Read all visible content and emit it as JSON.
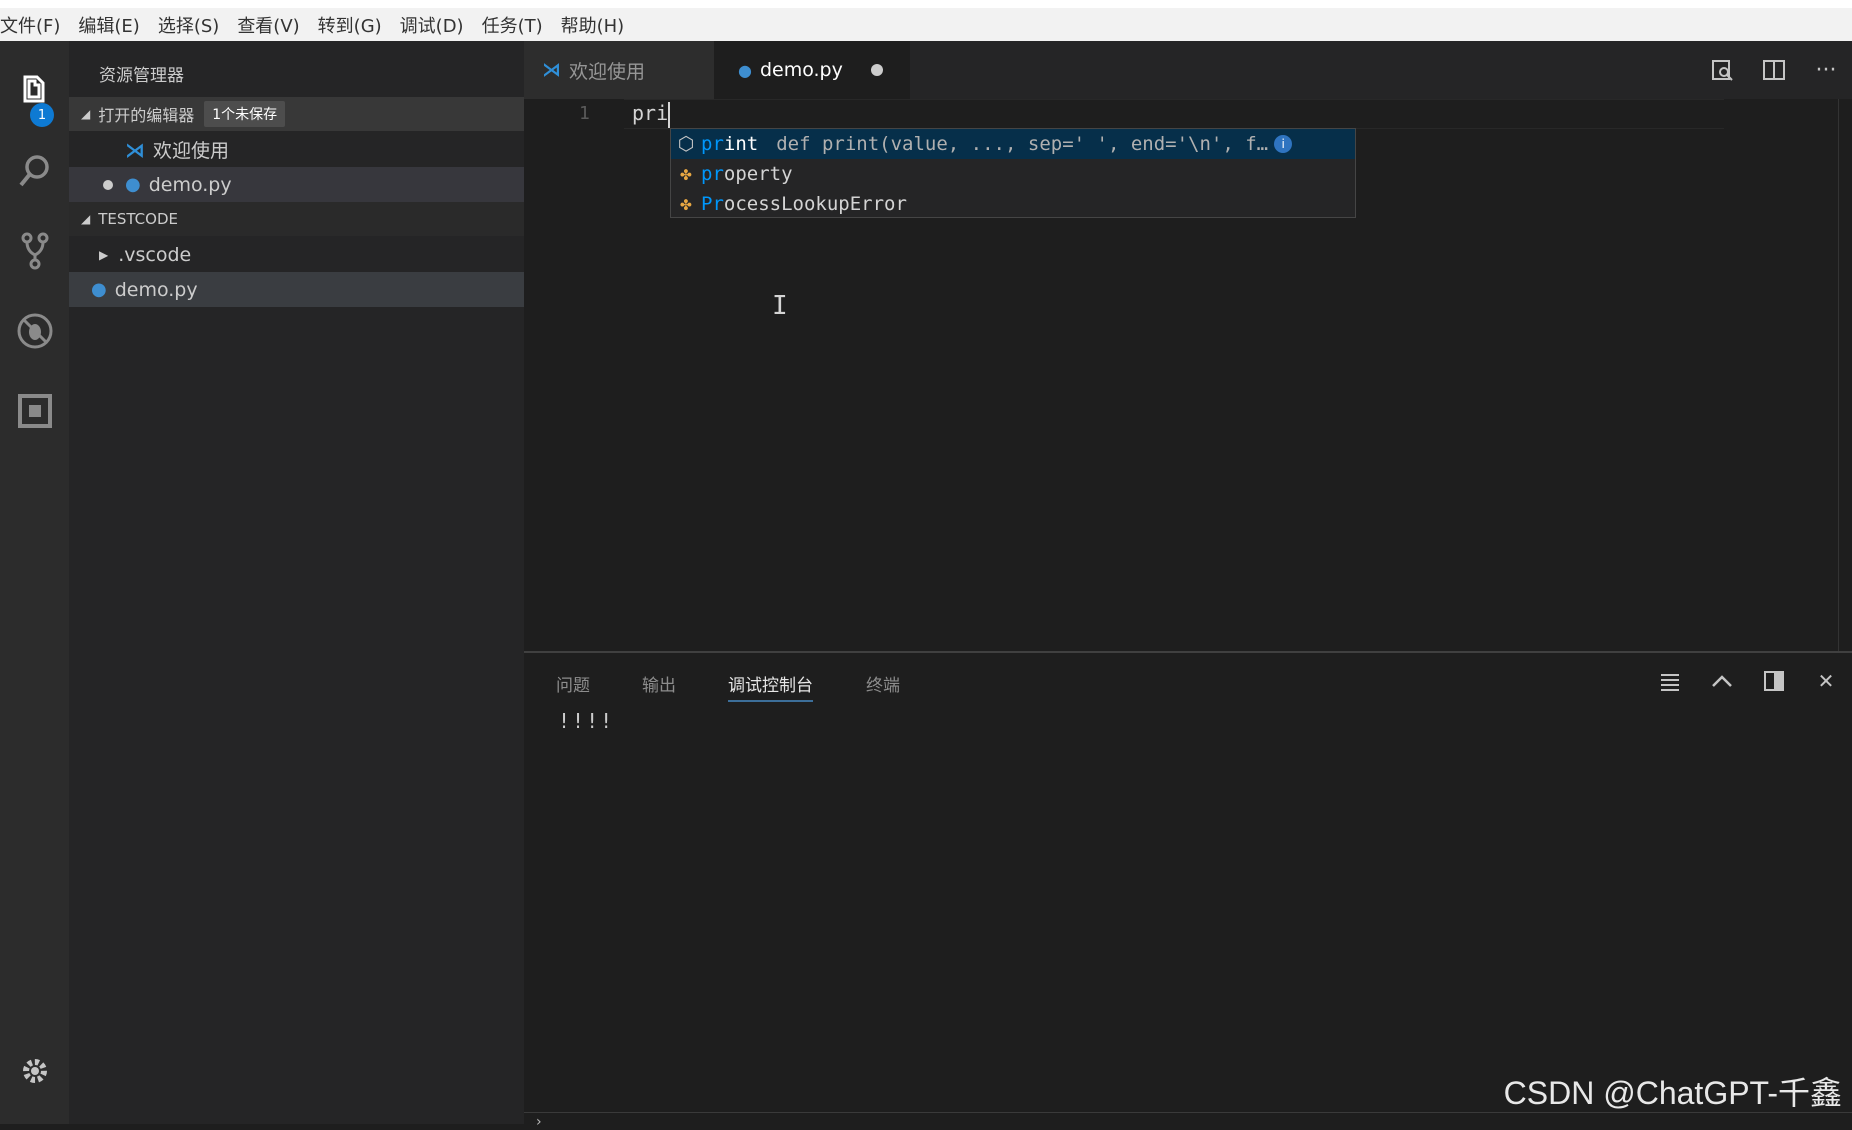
{
  "menubar": {
    "items": [
      "文件(F)",
      "编辑(E)",
      "选择(S)",
      "查看(V)",
      "转到(G)",
      "调试(D)",
      "任务(T)",
      "帮助(H)"
    ]
  },
  "activity_bar": {
    "explorer_badge": "1",
    "icons": [
      "files-icon",
      "search-icon",
      "source-control-icon",
      "debug-icon",
      "extensions-icon",
      "gear-icon"
    ]
  },
  "sidebar": {
    "title": "资源管理器",
    "open_editors": {
      "label": "打开的编辑器",
      "unsaved_badge": "1个未保存",
      "items": [
        {
          "label": "欢迎使用",
          "icon": "vscode-icon",
          "dirty": false
        },
        {
          "label": "demo.py",
          "icon": "python-icon",
          "dirty": true
        }
      ]
    },
    "workspace": {
      "label": "TESTCODE",
      "items": [
        {
          "label": ".vscode",
          "type": "folder"
        },
        {
          "label": "demo.py",
          "type": "file"
        }
      ]
    }
  },
  "tabs": [
    {
      "label": "欢迎使用",
      "active": false
    },
    {
      "label": "demo.py",
      "active": true,
      "dirty": true
    }
  ],
  "editor": {
    "line_number": "1",
    "code": "pri",
    "suggestions": [
      {
        "highlight": "pr",
        "rest": "int",
        "detail": "def print(value, ..., sep=' ', end='\\n', f…",
        "icon": "module-icon",
        "selected": true
      },
      {
        "highlight": "pr",
        "rest": "operty",
        "detail": "",
        "icon": "class-icon",
        "selected": false
      },
      {
        "highlight": "Pr",
        "rest": "ocessLookupError",
        "detail": "",
        "icon": "class-icon",
        "selected": false
      }
    ],
    "info_icon": "i"
  },
  "panel": {
    "tabs": [
      "问题",
      "输出",
      "调试控制台",
      "终端"
    ],
    "active_tab": "调试控制台",
    "output": "!!!!"
  },
  "watermark": "CSDN @ChatGPT-千鑫",
  "colors": {
    "accent": "#0e7ad3",
    "highlight": "#0097fb",
    "python": "#3e8ed0"
  }
}
